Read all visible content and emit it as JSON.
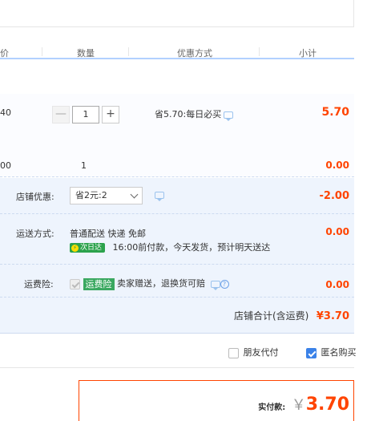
{
  "columns": [
    "价",
    "数量",
    "优惠方式",
    "小计"
  ],
  "item1": {
    "price_fragment": "40",
    "quantity": "1",
    "minus": "—",
    "plus": "+",
    "promo_text": "省5.70:每日必买",
    "subtotal": "5.70"
  },
  "item2": {
    "price_fragment": "00",
    "quantity": "1",
    "subtotal": "0.00"
  },
  "shop_discount": {
    "label": "店铺优惠:",
    "selected": "省2元:2",
    "value": "-2.00"
  },
  "shipping": {
    "label": "运送方式:",
    "method": "普通配送 快递 免邮",
    "badge": "次日达",
    "note": "16:00前付款，今天发货，预计明天送达",
    "value": "0.00"
  },
  "insurance": {
    "label": "运费险:",
    "badge": "运费险",
    "desc": "卖家赠送，退换货可赔",
    "value": "0.00"
  },
  "shop_total": {
    "label": "店铺合计(含运费)",
    "value": "¥3.70"
  },
  "options": {
    "friend_pay": "朋友代付",
    "anonymous": "匿名购买"
  },
  "payment": {
    "label": "实付款:",
    "currency": "￥",
    "value": "3.70"
  },
  "colors": {
    "accent": "#ff4400",
    "header_line": "#b2d1ff",
    "section_bg": "#eef4fd",
    "checkbox_blue": "#3b82e8"
  }
}
